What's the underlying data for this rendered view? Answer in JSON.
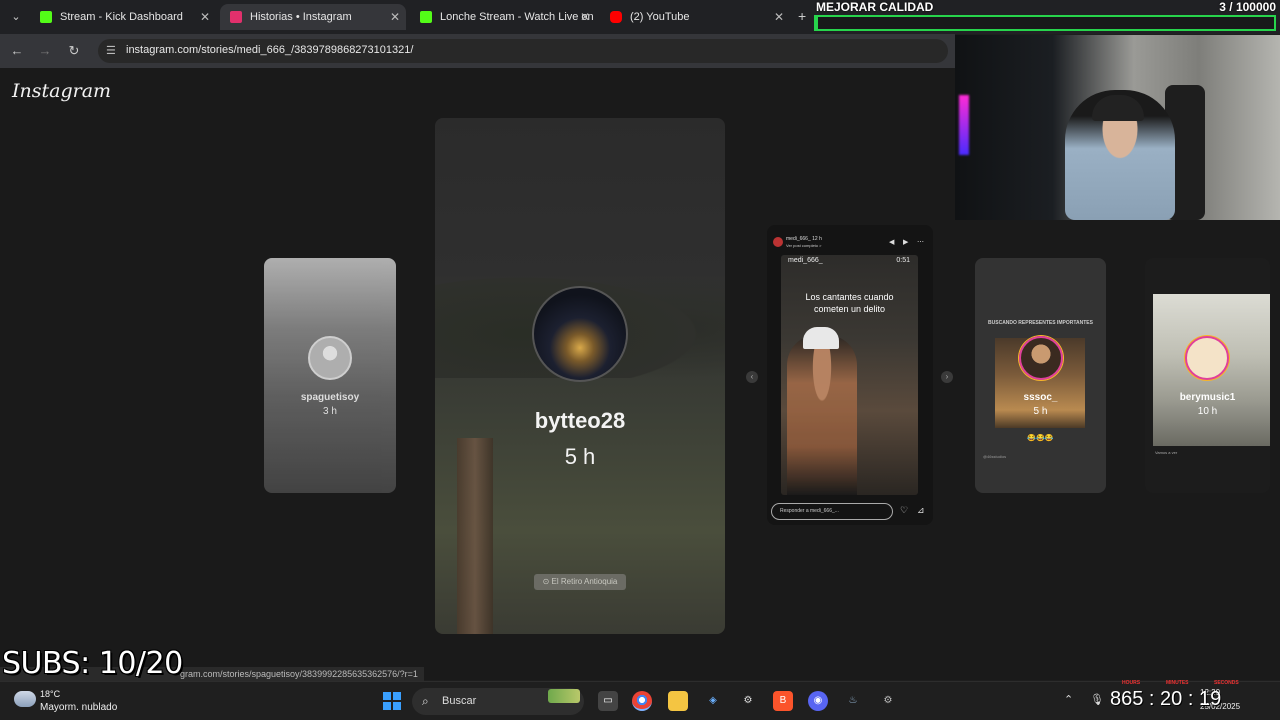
{
  "browser": {
    "tabs": [
      {
        "label": "Stream - Kick Dashboard",
        "color": "#53fc18"
      },
      {
        "label": "Historias • Instagram",
        "color": "#e1306c"
      },
      {
        "label": "Lonche Stream - Watch Live on",
        "color": "#53fc18"
      },
      {
        "label": "(2) YouTube",
        "color": "#ff0000"
      }
    ],
    "url": "instagram.com/stories/medi_666_/3839789868273101321/"
  },
  "instagram": {
    "logo": "Instagram",
    "main_story": {
      "user": "bytteo28",
      "time": "5 h",
      "location": "El Retiro Antioquia"
    },
    "left_story": {
      "user": "spaguetisoy",
      "time": "3 h"
    },
    "active_story": {
      "user": "medi_666_",
      "time": "12 h",
      "sub": "Ver post completo >",
      "media_user": "medi_666_",
      "media_time": "0:51",
      "caption": "Los cantantes cuando cometen un delito",
      "reply_placeholder": "Responder a medi_666_..."
    },
    "right_story_1": {
      "user": "sssoc_",
      "time": "5 h",
      "header": "BUSCANDO REPRESENTES IMPORTANTES",
      "emoji": "😂😂😂",
      "footer": "@46sstudios"
    },
    "right_story_2": {
      "user": "berymusic1",
      "time": "10 h",
      "footer": "Vamos a ver"
    }
  },
  "overlay": {
    "goal_title": "MEJORAR CALIDAD",
    "goal_count": "3 / 100000",
    "goal_progress": 3e-05,
    "subs": "SUBS: 10/20",
    "status_url": "gram.com/stories/spaguetisoy/3839992285635362576/?r=1",
    "timer": "865 : 20 : 19",
    "timer_labels": [
      "HOURS",
      "MINUTES",
      "SECONDS"
    ]
  },
  "taskbar": {
    "weather_temp": "18°C",
    "weather_desc": "Mayorm. nublado",
    "search": "Buscar",
    "time": "12:20",
    "date": "25/02/2025",
    "apps": [
      "file-explorer",
      "chrome",
      "folder",
      "app",
      "chatgpt",
      "brave",
      "discord",
      "steam",
      "settings"
    ]
  }
}
